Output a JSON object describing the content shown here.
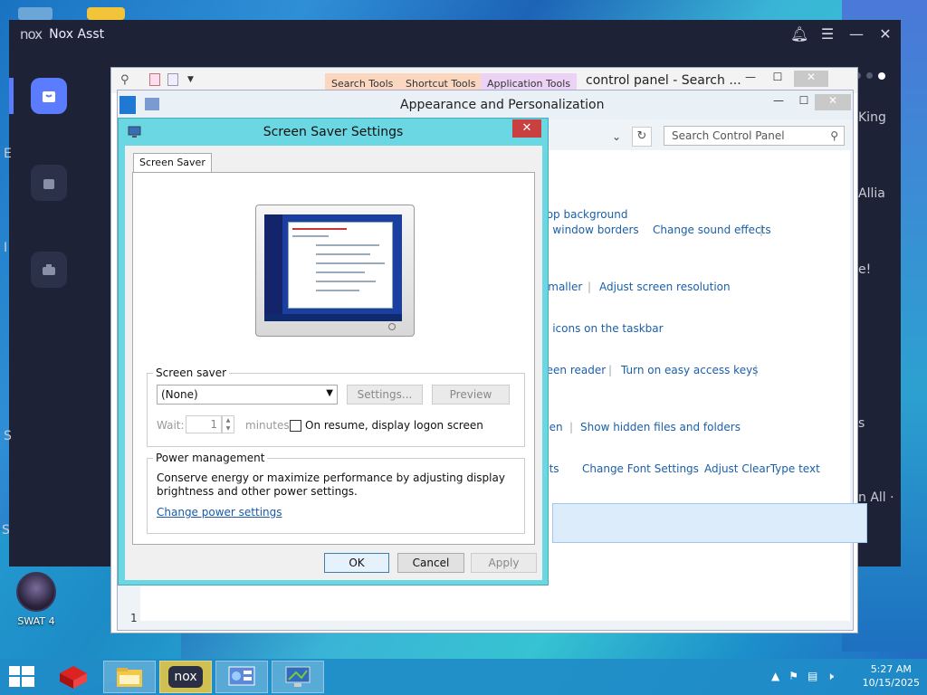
{
  "nox": {
    "title": "Nox Asst",
    "logo": "nox",
    "right_texts": [
      "King",
      "Allia",
      "e!",
      "s",
      "n All ·",
      "es"
    ],
    "left_texts": [
      "E",
      "I",
      "S",
      "S"
    ]
  },
  "control_panel": {
    "ribbon_tabs": [
      "Search Tools",
      "Shortcut Tools",
      "Application Tools"
    ],
    "window_title": "control panel - Search ...",
    "inner_title": "Appearance and Personalization",
    "search_placeholder": "Search Control Panel",
    "links": [
      {
        "text": "top background"
      },
      {
        "text": "d window borders"
      },
      {
        "text": "Change sound effects"
      },
      {
        "text": "smaller"
      },
      {
        "text": "Adjust screen resolution"
      },
      {
        "text": "e icons on the taskbar"
      },
      {
        "text": "reen reader"
      },
      {
        "text": "Turn on easy access keys"
      },
      {
        "text": "pen"
      },
      {
        "text": "Show hidden files and folders"
      },
      {
        "text": "nts"
      },
      {
        "text": "Change Font Settings"
      },
      {
        "text": "Adjust ClearType text"
      }
    ],
    "status_fragment": "1"
  },
  "dialog": {
    "title": "Screen Saver Settings",
    "close_label": "✕",
    "tab": "Screen Saver",
    "screensaver_legend": "Screen saver",
    "screensaver_value": "(None)",
    "settings_btn": "Settings...",
    "preview_btn": "Preview",
    "wait_label": "Wait:",
    "wait_value": "1",
    "minutes_label": "minutes",
    "resume_label": "On resume, display logon screen",
    "power_legend": "Power management",
    "power_text1": "Conserve energy or maximize performance by adjusting display",
    "power_text2": "brightness and other power settings.",
    "power_link": "Change power settings",
    "ok": "OK",
    "cancel": "Cancel",
    "apply": "Apply"
  },
  "desktop": {
    "icon_label": "SWAT 4"
  },
  "taskbar": {
    "time": "5:27 AM",
    "date": "10/15/2025",
    "items": [
      "winrar-icon",
      "file-explorer-icon",
      "nox-icon",
      "control-panel-icon",
      "screen-saver-icon"
    ]
  }
}
